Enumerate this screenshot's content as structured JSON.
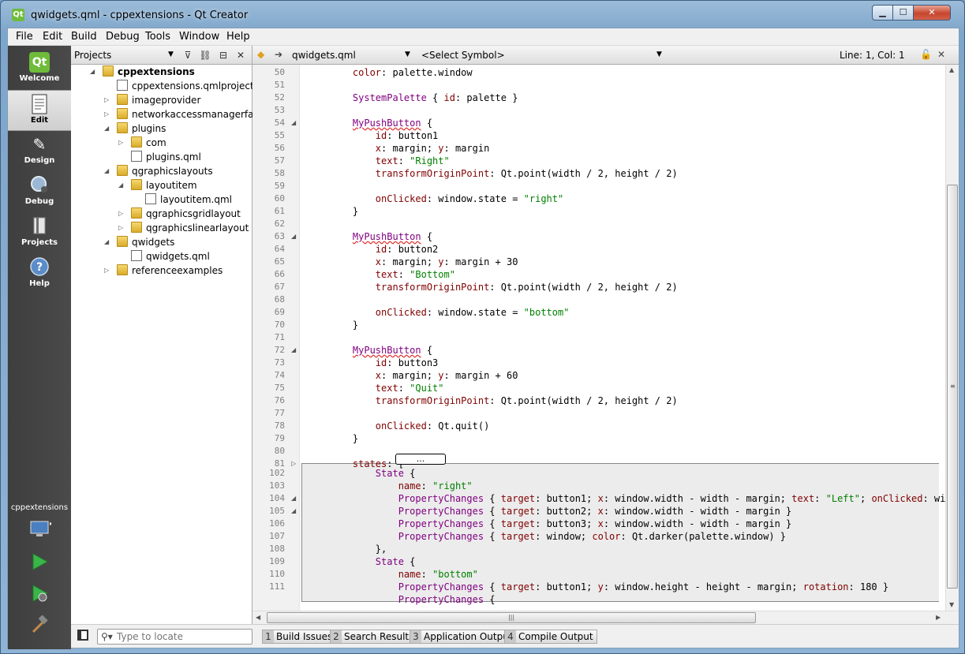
{
  "window": {
    "title": "qwidgets.qml - cppextensions - Qt Creator",
    "app_icon": "Qt",
    "minimize_glyph": "▁",
    "maximize_glyph": "☐",
    "close_glyph": "✕"
  },
  "menu": [
    "File",
    "Edit",
    "Build",
    "Debug",
    "Tools",
    "Window",
    "Help"
  ],
  "modes": [
    {
      "label": "Welcome",
      "icon": "qt-logo-icon"
    },
    {
      "label": "Edit",
      "icon": "document-icon"
    },
    {
      "label": "Design",
      "icon": "design-pen-icon"
    },
    {
      "label": "Debug",
      "icon": "bug-icon"
    },
    {
      "label": "Projects",
      "icon": "projects-icon"
    },
    {
      "label": "Help",
      "icon": "help-icon"
    }
  ],
  "kit_selector": {
    "label": "cppextensions"
  },
  "projects": {
    "title": "Projects",
    "tree": [
      {
        "label": "cppextensions",
        "indent": 0,
        "arrow": "◢",
        "type": "folder-qml",
        "bold": true
      },
      {
        "label": "cppextensions.qmlproject",
        "indent": 1,
        "arrow": "",
        "type": "file"
      },
      {
        "label": "imageprovider",
        "indent": 1,
        "arrow": "▷",
        "type": "folder"
      },
      {
        "label": "networkaccessmanagerfactory",
        "indent": 1,
        "arrow": "▷",
        "type": "folder"
      },
      {
        "label": "plugins",
        "indent": 1,
        "arrow": "◢",
        "type": "folder"
      },
      {
        "label": "com",
        "indent": 2,
        "arrow": "▷",
        "type": "folder"
      },
      {
        "label": "plugins.qml",
        "indent": 2,
        "arrow": "",
        "type": "qml"
      },
      {
        "label": "qgraphicslayouts",
        "indent": 1,
        "arrow": "◢",
        "type": "folder"
      },
      {
        "label": "layoutitem",
        "indent": 2,
        "arrow": "◢",
        "type": "folder"
      },
      {
        "label": "layoutitem.qml",
        "indent": 3,
        "arrow": "",
        "type": "qml"
      },
      {
        "label": "qgraphicsgridlayout",
        "indent": 2,
        "arrow": "▷",
        "type": "folder"
      },
      {
        "label": "qgraphicslinearlayout",
        "indent": 2,
        "arrow": "▷",
        "type": "folder"
      },
      {
        "label": "qwidgets",
        "indent": 1,
        "arrow": "◢",
        "type": "folder"
      },
      {
        "label": "qwidgets.qml",
        "indent": 2,
        "arrow": "",
        "type": "qml"
      },
      {
        "label": "referenceexamples",
        "indent": 1,
        "arrow": "▷",
        "type": "folder"
      }
    ]
  },
  "editor": {
    "file": "qwidgets.qml",
    "symbol": "<Select Symbol>",
    "position": "Line: 1, Col: 1",
    "collapsed_marker": "...",
    "lines": [
      {
        "n": "50",
        "html": "    <span class='k-prop'>color</span>: palette.window"
      },
      {
        "n": "51",
        "html": ""
      },
      {
        "n": "52",
        "html": "    <span class='k-type2'>SystemPalette</span> { <span class='k-prop'>id</span>: palette }"
      },
      {
        "n": "53",
        "html": ""
      },
      {
        "n": "54",
        "fold": "◢",
        "html": "    <span class='k-type'>MyPushButton</span> {"
      },
      {
        "n": "55",
        "html": "        <span class='k-prop'>id</span>: button1"
      },
      {
        "n": "56",
        "html": "        <span class='k-prop'>x</span>: margin; <span class='k-prop'>y</span>: margin"
      },
      {
        "n": "57",
        "html": "        <span class='k-prop'>text</span>: <span class='k-str'>\"Right\"</span>"
      },
      {
        "n": "58",
        "html": "        <span class='k-prop'>transformOriginPoint</span>: Qt.point(width / 2, height / 2)"
      },
      {
        "n": "59",
        "html": ""
      },
      {
        "n": "60",
        "html": "        <span class='k-prop'>onClicked</span>: window.state = <span class='k-str'>\"right\"</span>"
      },
      {
        "n": "61",
        "html": "    }"
      },
      {
        "n": "62",
        "html": ""
      },
      {
        "n": "63",
        "fold": "◢",
        "html": "    <span class='k-type'>MyPushButton</span> {"
      },
      {
        "n": "64",
        "html": "        <span class='k-prop'>id</span>: button2"
      },
      {
        "n": "65",
        "html": "        <span class='k-prop'>x</span>: margin; <span class='k-prop'>y</span>: margin + 30"
      },
      {
        "n": "66",
        "html": "        <span class='k-prop'>text</span>: <span class='k-str'>\"Bottom\"</span>"
      },
      {
        "n": "67",
        "html": "        <span class='k-prop'>transformOriginPoint</span>: Qt.point(width / 2, height / 2)"
      },
      {
        "n": "68",
        "html": ""
      },
      {
        "n": "69",
        "html": "        <span class='k-prop'>onClicked</span>: window.state = <span class='k-str'>\"bottom\"</span>"
      },
      {
        "n": "70",
        "html": "    }"
      },
      {
        "n": "71",
        "html": ""
      },
      {
        "n": "72",
        "fold": "◢",
        "html": "    <span class='k-type'>MyPushButton</span> {"
      },
      {
        "n": "73",
        "html": "        <span class='k-prop'>id</span>: button3"
      },
      {
        "n": "74",
        "html": "        <span class='k-prop'>x</span>: margin; <span class='k-prop'>y</span>: margin + 60"
      },
      {
        "n": "75",
        "html": "        <span class='k-prop'>text</span>: <span class='k-str'>\"Quit\"</span>"
      },
      {
        "n": "76",
        "html": "        <span class='k-prop'>transformOriginPoint</span>: Qt.point(width / 2, height / 2)"
      },
      {
        "n": "77",
        "html": ""
      },
      {
        "n": "78",
        "html": "        <span class='k-prop'>onClicked</span>: Qt.quit()"
      },
      {
        "n": "79",
        "html": "    }"
      },
      {
        "n": "80",
        "html": ""
      },
      {
        "n": "81",
        "fold": "▷",
        "html": "    <span class='k-prop'>states</span>: ["
      },
      {
        "n": "102",
        "html": "        <span class='k-type2'>State</span> {"
      },
      {
        "n": "103",
        "html": "            <span class='k-prop'>name</span>: <span class='k-str'>\"right\"</span>"
      },
      {
        "n": "104",
        "fold": "◢",
        "html": "            <span class='k-type2'>PropertyChanges</span> { <span class='k-prop'>target</span>: button1; <span class='k-prop'>x</span>: window.width - width - margin; <span class='k-prop'>text</span>: <span class='k-str'>\"Left\"</span>; <span class='k-prop'>onClicked</span>: window.state = <span class='k-str'>\"\"</span> }"
      },
      {
        "n": "105",
        "fold": "◢",
        "html": "            <span class='k-type2'>PropertyChanges</span> { <span class='k-prop'>target</span>: button2; <span class='k-prop'>x</span>: window.width - width - margin }"
      },
      {
        "n": "106",
        "html": "            <span class='k-type2'>PropertyChanges</span> { <span class='k-prop'>target</span>: button3; <span class='k-prop'>x</span>: window.width - width - margin }"
      },
      {
        "n": "107",
        "html": "            <span class='k-type2'>PropertyChanges</span> { <span class='k-prop'>target</span>: window; <span class='k-prop'>color</span>: Qt.darker(palette.window) }"
      },
      {
        "n": "108",
        "html": "        },"
      },
      {
        "n": "109",
        "html": "        <span class='k-type2'>State</span> {"
      },
      {
        "n": "110",
        "html": "            <span class='k-prop'>name</span>: <span class='k-str'>\"bottom\"</span>"
      },
      {
        "n": "111",
        "html": "            <span class='k-type2'>PropertyChanges</span> { <span class='k-prop'>target</span>: button1; <span class='k-prop'>y</span>: window.height - height - margin; <span class='k-prop'>rotation</span>: 180 }"
      },
      {
        "n": "",
        "html": "            <span class='k-type2'>PropertyChanges</span> {"
      }
    ]
  },
  "statusbar": {
    "locator_placeholder": "Type to locate",
    "tabs": [
      {
        "num": "1",
        "label": "Build Issues"
      },
      {
        "num": "2",
        "label": "Search Results"
      },
      {
        "num": "3",
        "label": "Application Output"
      },
      {
        "num": "4",
        "label": "Compile Output"
      }
    ]
  }
}
